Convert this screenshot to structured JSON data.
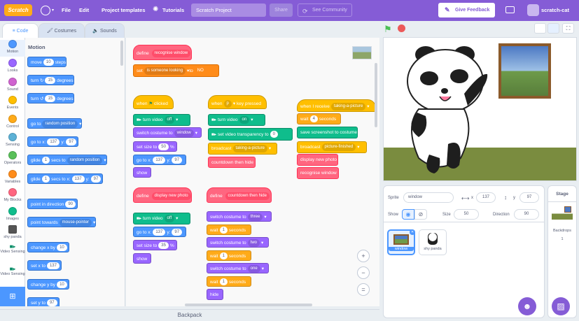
{
  "menubar": {
    "logo": "Scratch",
    "file": "File",
    "edit": "Edit",
    "templates": "Project templates",
    "tutorials": "Tutorials",
    "project_title": "Scratch Project",
    "share": "Share",
    "see_community": "See Community",
    "give_feedback": "Give Feedback",
    "username": "scratch-cat"
  },
  "tabs": {
    "code": "Code",
    "costumes": "Costumes",
    "sounds": "Sounds"
  },
  "categories": [
    {
      "label": "Motion",
      "color": "#4c97ff"
    },
    {
      "label": "Looks",
      "color": "#9966ff"
    },
    {
      "label": "Sound",
      "color": "#cf63cf"
    },
    {
      "label": "Events",
      "color": "#ffbf00"
    },
    {
      "label": "Control",
      "color": "#ffab19"
    },
    {
      "label": "Sensing",
      "color": "#5cb1d6"
    },
    {
      "label": "Operators",
      "color": "#59c059"
    },
    {
      "label": "Variables",
      "color": "#ff8c1a"
    },
    {
      "label": "My Blocks",
      "color": "#ff6680"
    },
    {
      "label": "Images",
      "color": "#0fbd8c"
    },
    {
      "label": "shy panda",
      "color": "#555555"
    },
    {
      "label": "Video Sensing",
      "color": "#0fbd8c"
    },
    {
      "label": "Video Sensing",
      "color": "#0fbd8c"
    }
  ],
  "palette": {
    "heading": "Motion",
    "move": "move",
    "move_val": "10",
    "steps": "steps",
    "turn": "turn",
    "turn_r_val": "15",
    "degrees": "degrees",
    "turn_l_val": "15",
    "goto": "go to",
    "goto_dd": "random position",
    "gotoxy": "go to x:",
    "gotoxy_x": "137",
    "y": "y:",
    "gotoxy_y": "97",
    "glide": "glide",
    "glide_val": "1",
    "secs_to": "secs to",
    "glide_dd": "random position",
    "glide2_val": "1",
    "secs_to_x": "secs to x:",
    "glide2_x": "137",
    "glide2_y": "97",
    "point_dir": "point in direction",
    "point_dir_val": "90",
    "point_towards": "point towards",
    "point_towards_dd": "mouse-pointer",
    "change_x": "change x by",
    "change_x_val": "10",
    "set_x": "set x to",
    "set_x_val": "137",
    "change_y": "change y by",
    "change_y_val": "10",
    "set_y": "set y to",
    "set_y_val": "97"
  },
  "scripts": {
    "s1": {
      "define": "define",
      "name": "recognise window",
      "set": "set",
      "set_dd": "is someone looking",
      "to": "to",
      "val": "NO"
    },
    "s2": {
      "when": "when",
      "clicked": "clicked",
      "turn_video": "turn video",
      "video_dd": "off",
      "switch_costume": "switch costume to",
      "costume_dd": "window",
      "set_size": "set size to",
      "size_val": "50",
      "pct": "%",
      "goto": "go to x:",
      "x": "137",
      "y_lbl": "y:",
      "y": "97",
      "show": "show"
    },
    "s3": {
      "when": "when",
      "key": "p",
      "key_pressed": "key pressed",
      "turn_video": "turn video",
      "video_dd": "on",
      "set_transparency": "set video transparency to",
      "transparency_val": "0",
      "broadcast": "broadcast",
      "broadcast_dd": "taking-a-picture",
      "countdown": "countdown then hide"
    },
    "s4": {
      "when_receive": "when I receive",
      "receive_dd": "taking-a-picture",
      "wait": "wait",
      "wait_val": "4",
      "seconds": "seconds",
      "screenshot": "save screenshot to costume",
      "broadcast": "broadcast",
      "broadcast_dd": "picture-finished",
      "display": "display new photo",
      "recognise": "recognise window"
    },
    "s5": {
      "define": "define",
      "name": "display new photo",
      "turn_video": "turn video",
      "video_dd": "off",
      "goto": "go to x:",
      "x": "137",
      "y_lbl": "y:",
      "y": "97",
      "set_size": "set size to",
      "size_val": "35",
      "pct": "%",
      "show": "show"
    },
    "s6": {
      "define": "define",
      "name": "countdown then hide",
      "switch1": "switch costume to",
      "c1": "three",
      "wait": "wait",
      "w1": "1",
      "seconds": "seconds",
      "c2": "two",
      "w2": "1",
      "c3": "one",
      "w3": "1",
      "hide": "hide"
    }
  },
  "backpack": "Backpack",
  "sprite_info": {
    "sprite_label": "Sprite",
    "sprite_name": "window",
    "x_label": "x",
    "x_val": "137",
    "y_label": "y",
    "y_val": "97",
    "show_label": "Show",
    "size_label": "Size",
    "size_val": "50",
    "direction_label": "Direction",
    "direction_val": "90"
  },
  "sprites": [
    {
      "name": "window"
    },
    {
      "name": "shy panda"
    }
  ],
  "stage_panel": {
    "title": "Stage",
    "backdrops_label": "Backdrops",
    "backdrops_count": "1"
  },
  "zoom": {
    "in": "+",
    "out": "−",
    "reset": "="
  }
}
